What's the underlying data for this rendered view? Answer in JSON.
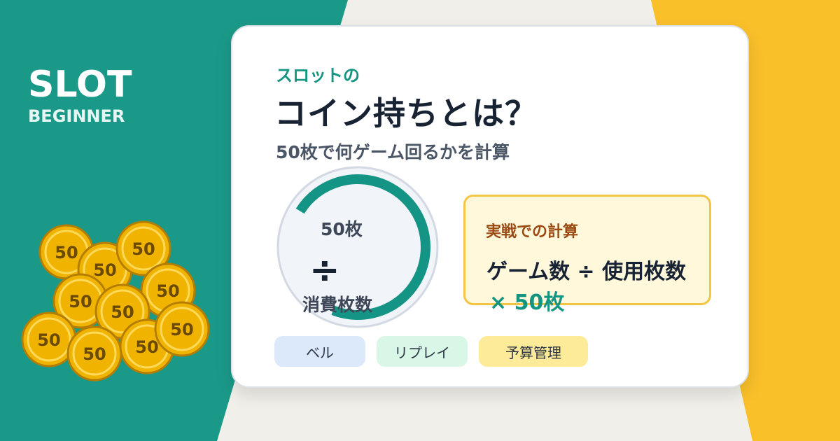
{
  "brand": {
    "line1": "SLOT",
    "line2": "BEGINNER"
  },
  "card": {
    "kicker": "スロットの",
    "title": "コイン持ちとは？",
    "subtitle": "50枚で何ゲーム回るかを計算"
  },
  "gauge": {
    "top_label": "50枚",
    "divide_symbol": "÷",
    "bottom_label": "消費枚数",
    "fill_fraction": 0.72
  },
  "formula": {
    "label": "実戦での計算",
    "line1": "ゲーム数 ÷ 使用枚数",
    "line2": "× 50枚"
  },
  "tags": [
    "ベル",
    "リプレイ",
    "予算管理"
  ],
  "coins": {
    "value_label": "50"
  },
  "colors": {
    "teal": "#159482",
    "yellow": "#f9c02a",
    "cream": "#f0efe9",
    "coin_gold": "#f0b400",
    "navy": "#172233"
  }
}
